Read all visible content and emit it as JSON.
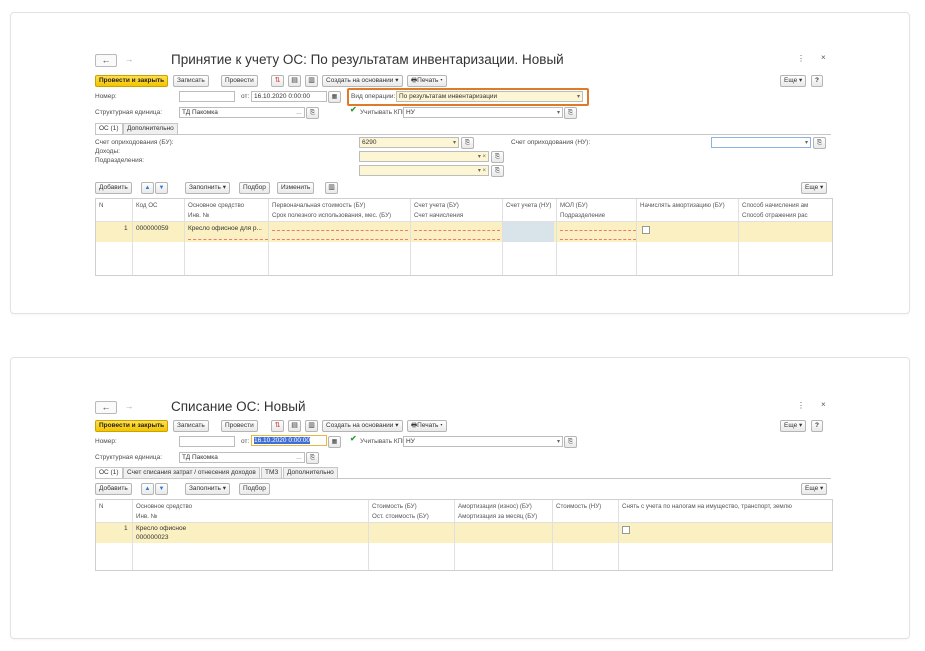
{
  "doc1": {
    "title": "Принятие к учету ОС: По результатам инвентаризации. Новый",
    "toolbar": {
      "post_close": "Провести и закрыть",
      "write": "Записать",
      "post": "Провести",
      "create_based": "Создать на основании",
      "print": "Печать",
      "more": "Еще",
      "help": "?"
    },
    "number_label": "Номер:",
    "date_label": "от:",
    "date_value": "16.10.2020  0:00:00",
    "op_label": "Вид операции:",
    "op_value": "По результатам инвентаризации",
    "unit_label": "Структурная единица:",
    "unit_value": "ТД Пакомка",
    "kpn_label": "Учитывать КПН",
    "kpn_value": "НУ",
    "tabs": [
      "ОС (1)",
      "Дополнительно"
    ],
    "acct_bu_label": "Счет оприходования (БУ):",
    "acct_bu_value": "6290",
    "income_label": "Доходы:",
    "dept_label": "Подразделения:",
    "acct_nu_label": "Счет оприходования (НУ):",
    "table_toolbar": {
      "add": "Добавить",
      "fill": "Заполнить",
      "pick": "Подбор",
      "change": "Изменить",
      "more": "Еще"
    },
    "columns_top": [
      "N",
      "Код ОС",
      "Основное средство",
      "Первоначальная стоимость (БУ)",
      "Счет учета (БУ)",
      "Счет учета (НУ)",
      "МОЛ (БУ)",
      "Начислять амортизацию (БУ)",
      "Способ начисления ам"
    ],
    "columns_bottom": [
      "",
      "",
      "Инв. №",
      "Срок полезного использования, мес. (БУ)",
      "Счет начисления",
      "",
      "Подразделение",
      "",
      "Способ отражения рас"
    ],
    "row": {
      "n": "1",
      "code": "000000059",
      "asset": "Кресло офисное для р..."
    }
  },
  "doc2": {
    "title": "Списание ОС: Новый",
    "toolbar": {
      "post_close": "Провести и закрыть",
      "write": "Записать",
      "post": "Провести",
      "create_based": "Создать на основании",
      "print": "Печать",
      "more": "Еще",
      "help": "?"
    },
    "number_label": "Номер:",
    "date_label": "от:",
    "date_value": "16.10.2020  0:00:00",
    "kpn_label": "Учитывать КПН",
    "kpn_value": "НУ",
    "unit_label": "Структурная единица:",
    "unit_value": "ТД Пакомка",
    "tabs": [
      "ОС (1)",
      "Счет списания затрат / отнесения доходов",
      "ТМЗ",
      "Дополнительно"
    ],
    "table_toolbar": {
      "add": "Добавить",
      "fill": "Заполнить",
      "pick": "Подбор",
      "more": "Еще"
    },
    "columns_top": [
      "N",
      "Основное средство",
      "Стоимость (БУ)",
      "Амортизация (износ) (БУ)",
      "Стоимость (НУ)",
      "Снять с учета по налогам на имущество, транспорт, землю"
    ],
    "columns_bottom": [
      "",
      "Инв. №",
      "Ост. стоимость (БУ)",
      "Амортизация за месяц (БУ)",
      "",
      ""
    ],
    "row": {
      "n": "1",
      "asset": "Кресло офисное",
      "inv": "000000023"
    }
  },
  "icons": {
    "back": "←",
    "forward": "→",
    "more_vert": "⋮",
    "close": "×",
    "up": "▲",
    "down": "▼",
    "calendar": "▦",
    "print": "🖶",
    "link": "⎘"
  },
  "colors": {
    "primary_button": "#f5c400",
    "highlight_border": "#e07a2b",
    "row_selected": "#fbf0c2",
    "field_yellow": "#fdf6d4"
  }
}
